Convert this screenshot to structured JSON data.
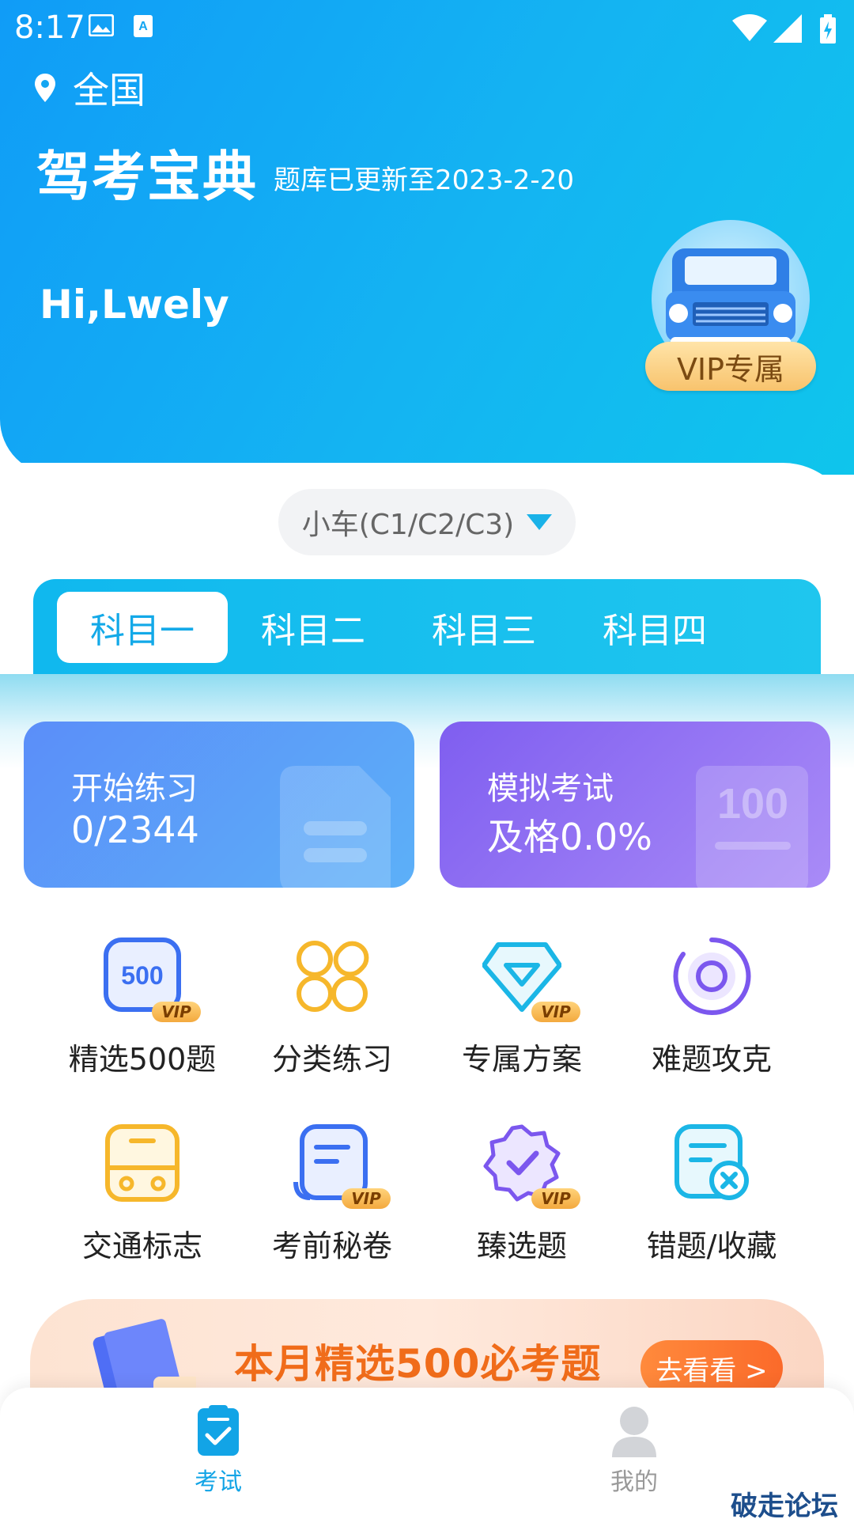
{
  "status_bar": {
    "time": "8:17"
  },
  "header": {
    "location": "全国",
    "app_title": "驾考宝典",
    "update_text": "题库已更新至2023-2-20",
    "greeting": "Hi,Lwely",
    "vip_label": "VIP专属"
  },
  "car_type": {
    "selected": "小车(C1/C2/C3)"
  },
  "subject_tabs": [
    {
      "label": "科目一",
      "active": true
    },
    {
      "label": "科目二",
      "active": false
    },
    {
      "label": "科目三",
      "active": false
    },
    {
      "label": "科目四",
      "active": false
    }
  ],
  "cards": {
    "practice": {
      "title": "开始练习",
      "value": "0/2344"
    },
    "exam": {
      "title": "模拟考试",
      "value": "及格0.0%",
      "deco_text": "100"
    }
  },
  "features": [
    {
      "label": "精选500题",
      "icon": "500-vip-icon",
      "vip": true,
      "icon_text": "500",
      "vip_text": "VIP"
    },
    {
      "label": "分类练习",
      "icon": "category-grid-icon",
      "vip": false
    },
    {
      "label": "专属方案",
      "icon": "diamond-icon",
      "vip": true,
      "vip_text": "VIP"
    },
    {
      "label": "难题攻克",
      "icon": "target-icon",
      "vip": false
    },
    {
      "label": "交通标志",
      "icon": "bus-icon",
      "vip": false
    },
    {
      "label": "考前秘卷",
      "icon": "scroll-icon",
      "vip": true,
      "vip_text": "VIP"
    },
    {
      "label": "臻选题",
      "icon": "badge-check-icon",
      "vip": true,
      "vip_text": "VIP"
    },
    {
      "label": "错题/收藏",
      "icon": "wrong-note-icon",
      "vip": false
    }
  ],
  "banner": {
    "text": "本月精选500必考题",
    "button": "去看看 >"
  },
  "bottom_nav": [
    {
      "label": "考试",
      "active": true
    },
    {
      "label": "我的",
      "active": false
    }
  ],
  "watermark": "破走论坛",
  "colors": {
    "primary": "#12a4e6",
    "vip_gold": "#f8c36d",
    "icon_yellow": "#f6b72b",
    "icon_purple": "#7b57ee",
    "icon_blue": "#3b6ff1",
    "icon_cyan": "#1bb6e6"
  }
}
